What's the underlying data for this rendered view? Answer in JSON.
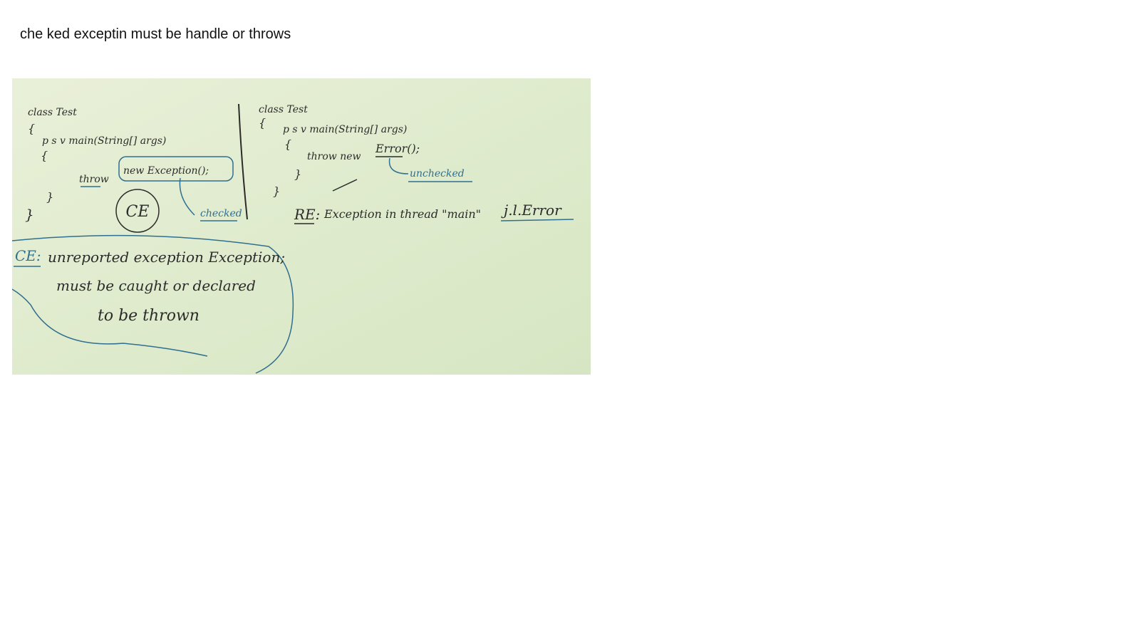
{
  "note": {
    "heading": "che ked exceptin must be handle or throws"
  },
  "whiteboard": {
    "colors": {
      "board_top": "#e9f0d8",
      "board_bottom": "#d6e6c3",
      "ink_black": "#2b2b2b",
      "ink_blue": "#2f6f8f"
    },
    "left_program": {
      "class_line": "class Test",
      "open_brace": "{",
      "main_sig": "p s v main(String[] args)",
      "main_open": "{",
      "throw_kw": "throw",
      "throw_rest": "new Exception();",
      "main_close": "}",
      "class_close": "}",
      "ce_circle": "CE",
      "checked_label": "checked"
    },
    "right_program": {
      "class_line": "class Test",
      "open_brace": "{",
      "main_sig": "p s v main(String[] args)",
      "main_open": "{",
      "throw_stmt": "throw new",
      "error_call": "Error();",
      "main_close": "}",
      "class_close": "}",
      "unchecked_label": "unchecked",
      "re_label": "RE:",
      "re_message": "Exception in thread \"main\"",
      "re_type": "j.l.Error"
    },
    "compile_error": {
      "label": "CE:",
      "line1": "unreported exception Exception;",
      "line2": "must be caught or declared",
      "line3": "to be thrown"
    }
  }
}
